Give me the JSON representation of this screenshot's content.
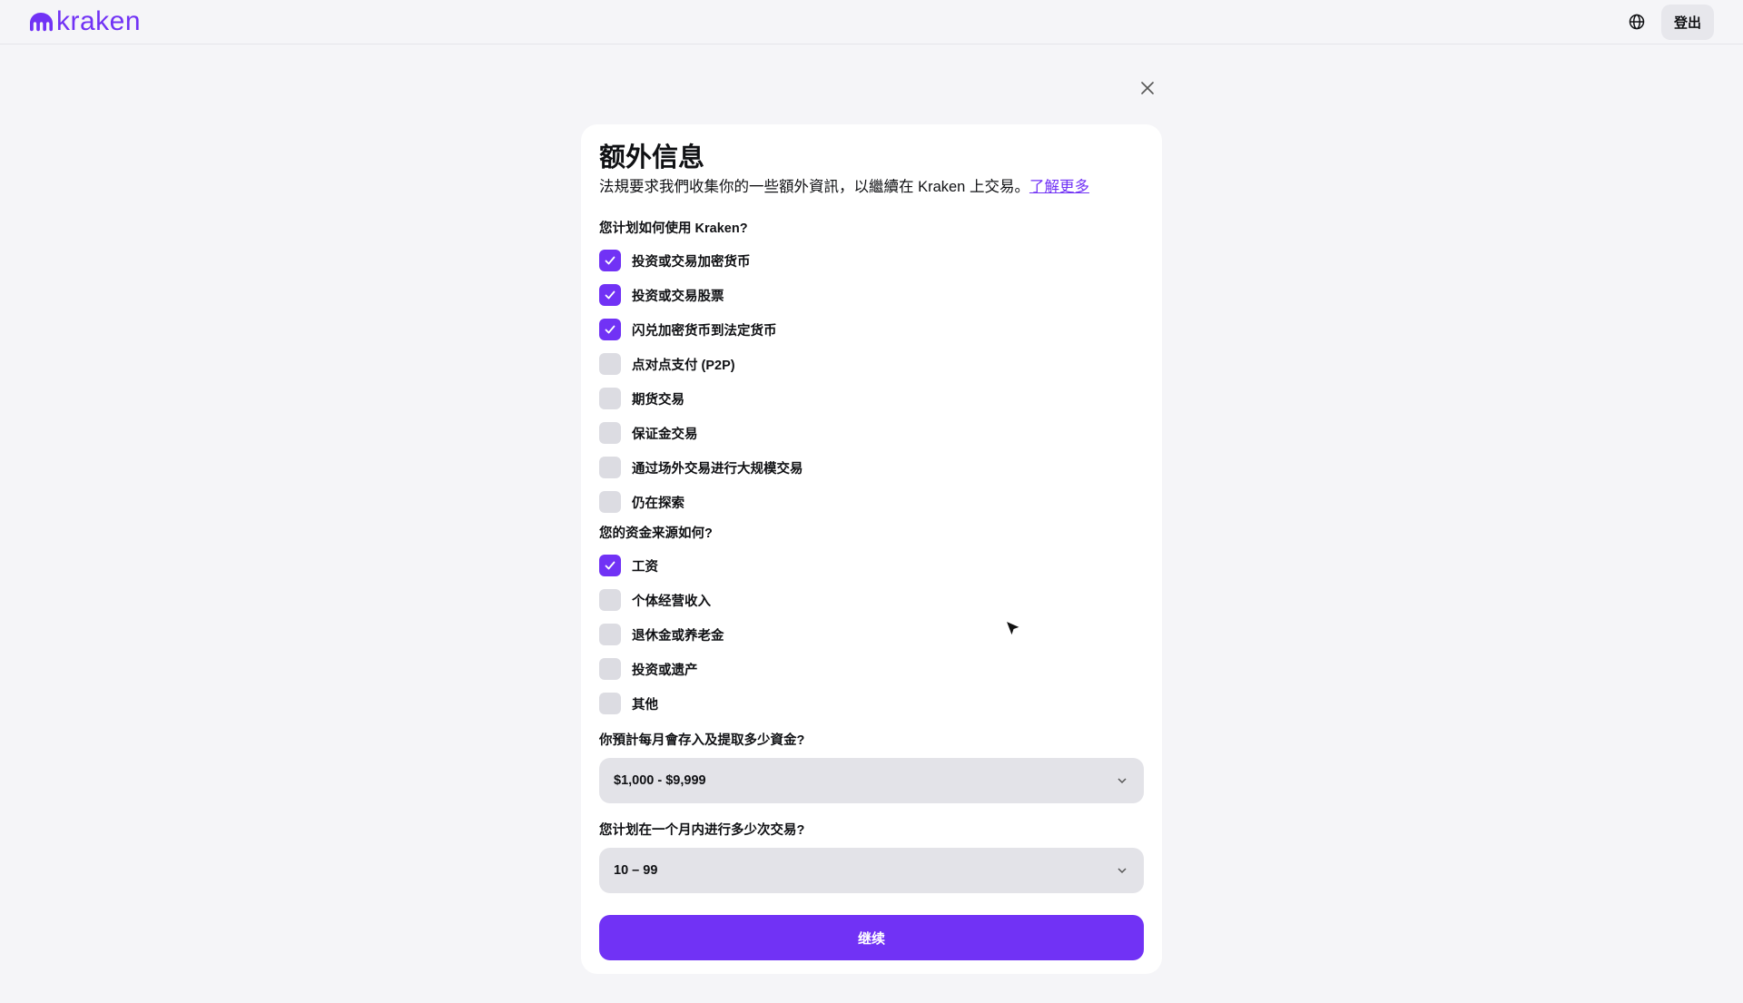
{
  "header": {
    "logo_text": "kraken",
    "logout_label": "登出",
    "globe_icon": "globe-icon"
  },
  "dialog": {
    "title": "额外信息",
    "subtitle": "法規要求我們收集你的一些額外資訊，以繼續在 Kraken 上交易。",
    "learn_more": "了解更多",
    "q_usage": "您计划如何使用 Kraken?",
    "usage_options": [
      {
        "label": "投资或交易加密货币",
        "checked": true
      },
      {
        "label": "投资或交易股票",
        "checked": true
      },
      {
        "label": "闪兑加密货币到法定货币",
        "checked": true
      },
      {
        "label": "点对点支付 (P2P)",
        "checked": false
      },
      {
        "label": "期货交易",
        "checked": false
      },
      {
        "label": "保证金交易",
        "checked": false
      },
      {
        "label": "通过场外交易进行大规模交易",
        "checked": false
      },
      {
        "label": "仍在探索",
        "checked": false
      }
    ],
    "q_funds": "您的资金来源如何?",
    "fund_options": [
      {
        "label": "工资",
        "checked": true
      },
      {
        "label": "个体经营收入",
        "checked": false
      },
      {
        "label": "退休金或养老金",
        "checked": false
      },
      {
        "label": "投资或遗产",
        "checked": false
      },
      {
        "label": "其他",
        "checked": false
      }
    ],
    "q_monthly_amount": "你預計每月會存入及提取多少資金?",
    "monthly_amount_value": "$1,000 - $9,999",
    "q_trade_count": "您计划在一个月内进行多少次交易?",
    "trade_count_value": "10 – 99",
    "continue_label": "继续"
  },
  "colors": {
    "accent": "#7132f5",
    "checkbox_off": "#dcdce2",
    "select_bg": "#e3e3e8",
    "page_bg": "#f5f5f8"
  }
}
